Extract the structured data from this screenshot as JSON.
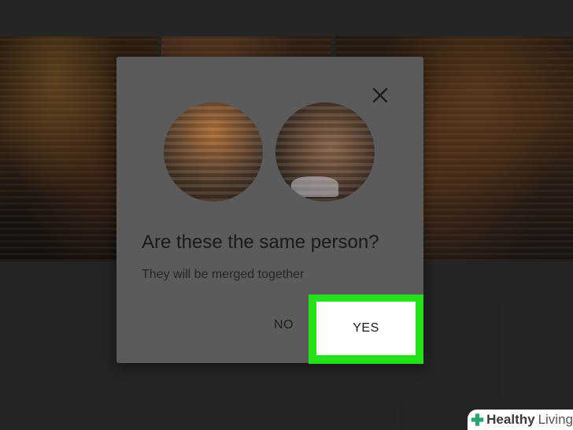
{
  "dialog": {
    "title": "Are these the same person?",
    "subtitle": "They will be merged together",
    "no_label": "NO",
    "yes_label": "YES",
    "close_icon": "close-icon"
  },
  "faces": [
    {
      "name": "face-thumbnail-1"
    },
    {
      "name": "face-thumbnail-2"
    }
  ],
  "background": {
    "photos": [
      "photo-1",
      "photo-2",
      "photo-3"
    ]
  },
  "highlight": {
    "color": "#22e01a",
    "target": "yes-button"
  },
  "watermark": {
    "brand": "Healthy",
    "suffix": "Living",
    "logo_color": "#27a76f"
  },
  "colors": {
    "dialog_bg": "#5b5b5b",
    "page_bg": "#3b3b3b"
  }
}
